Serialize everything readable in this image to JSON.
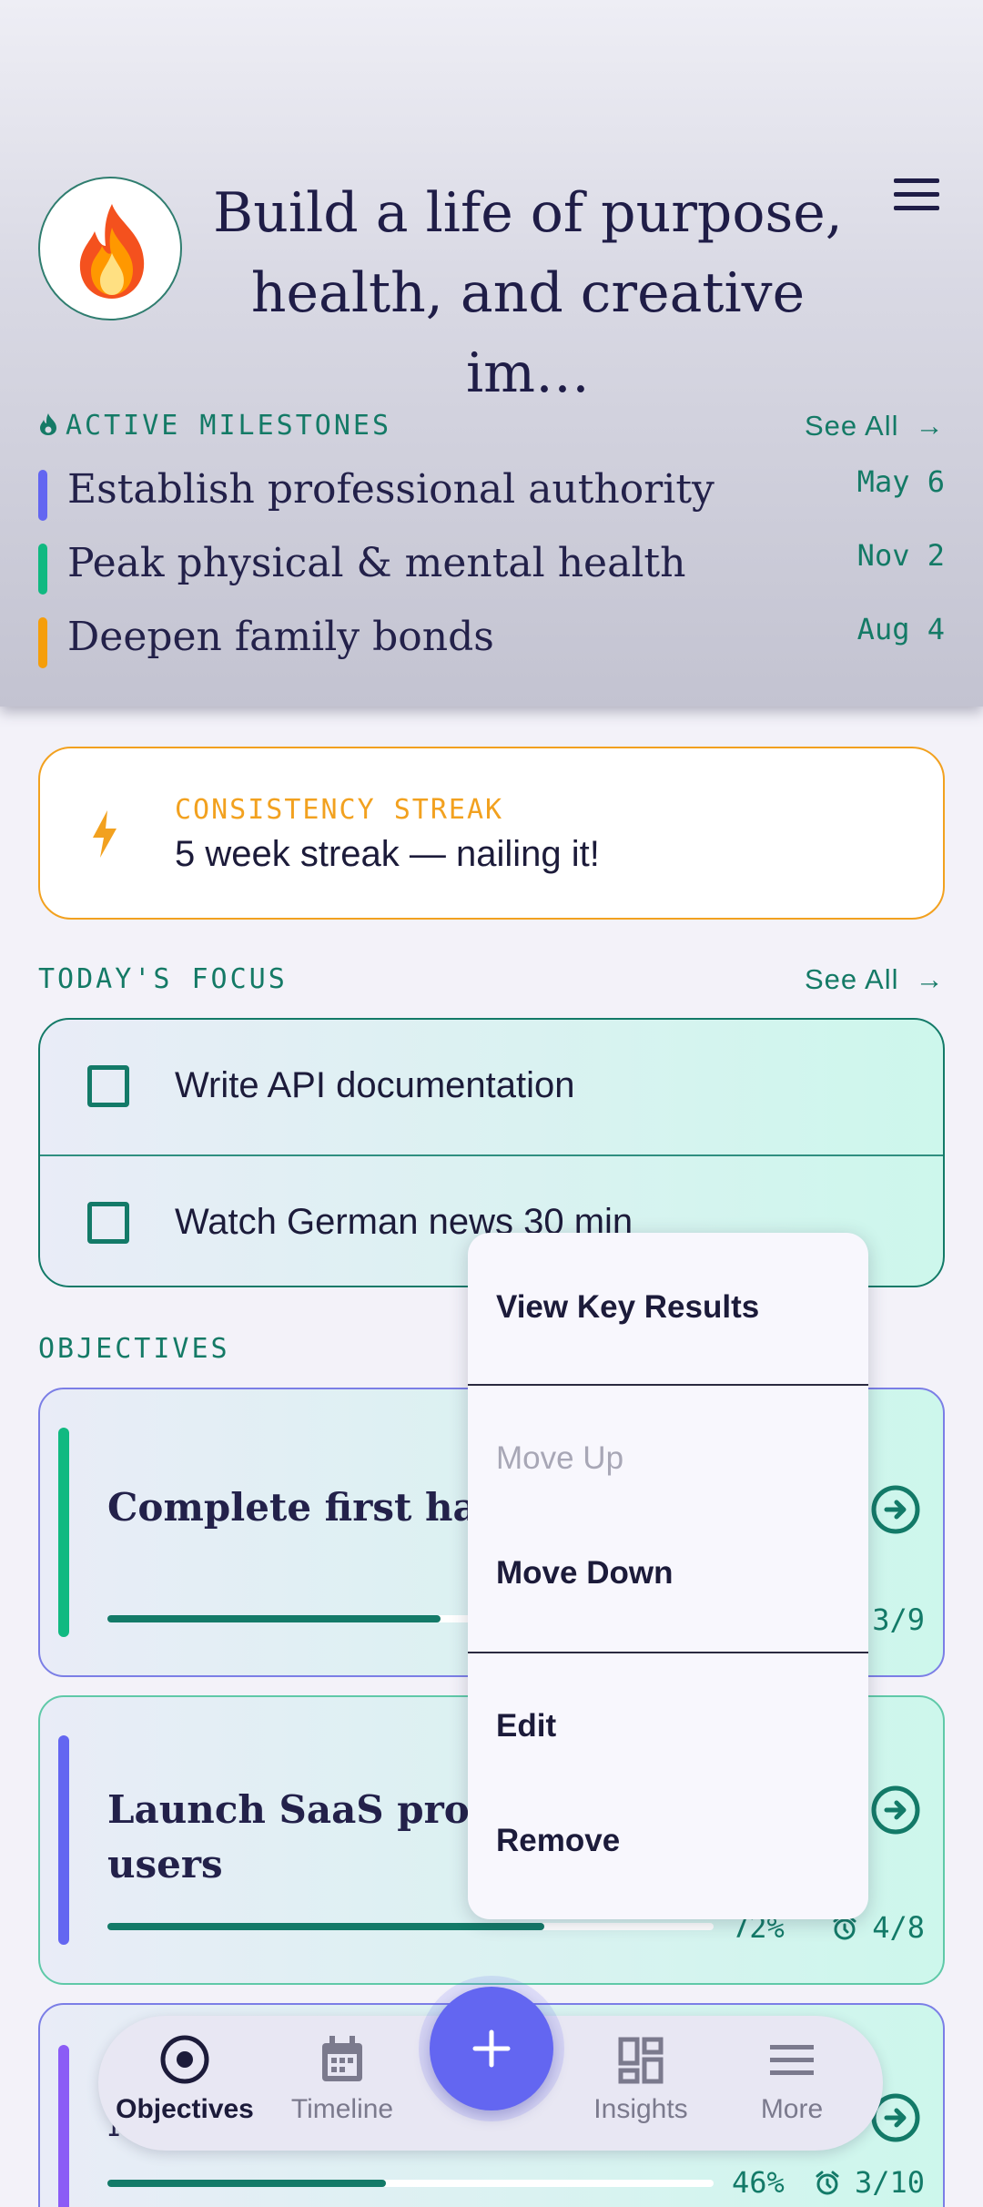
{
  "header": {
    "vision": "Build a life of purpose, health, and creative im…",
    "avatar_icon": "fire-icon",
    "menu_icon": "hamburger-menu-icon"
  },
  "milestones": {
    "label": "ACTIVE MILESTONES",
    "see_all": "See All",
    "items": [
      {
        "title": "Establish professional authority",
        "date": "May 6",
        "color": "#6366f1"
      },
      {
        "title": "Peak physical & mental health",
        "date": "Nov 2",
        "color": "#10b981"
      },
      {
        "title": "Deepen family bonds",
        "date": "Aug 4",
        "color": "#f59e0b"
      }
    ]
  },
  "streak": {
    "label": "CONSISTENCY STREAK",
    "text": "5 week streak — nailing it!",
    "icon": "lightning-bolt-icon"
  },
  "focus": {
    "label": "TODAY'S FOCUS",
    "see_all": "See All",
    "tasks": [
      {
        "text": "Write API documentation",
        "checked": false
      },
      {
        "text": "Watch German news 30 min",
        "checked": false
      }
    ]
  },
  "objectives": {
    "label": "OBJECTIVES",
    "items": [
      {
        "title": "Complete first half-r hours",
        "pct": "",
        "progress": 0.55,
        "count": "3/9",
        "color": "#10b981"
      },
      {
        "title": "Launch SaaS produc first 100 users",
        "pct": "72%",
        "progress": 0.72,
        "count": "4/8",
        "color": "#6366f1"
      },
      {
        "title": "N",
        "pct": "46%",
        "progress": 0.46,
        "count": "3/10",
        "color": "#8b5cf6"
      }
    ]
  },
  "context_menu": {
    "view_key_results": "View Key Results",
    "move_up": "Move Up",
    "move_down": "Move Down",
    "edit": "Edit",
    "remove": "Remove"
  },
  "nav": {
    "objectives": "Objectives",
    "timeline": "Timeline",
    "insights": "Insights",
    "more": "More",
    "add_icon": "plus-icon"
  }
}
